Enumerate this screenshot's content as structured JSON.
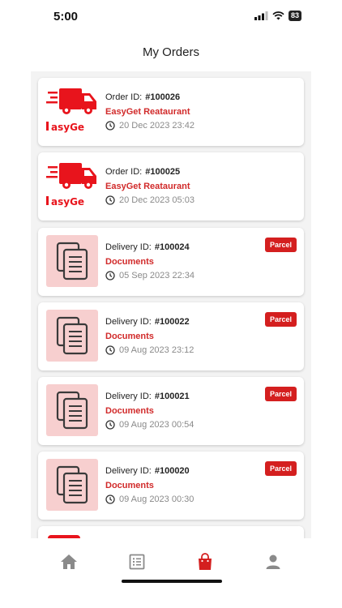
{
  "status_bar": {
    "time": "5:00",
    "battery": "83"
  },
  "header": {
    "title": "My Orders"
  },
  "colors": {
    "accent": "#d12a2a",
    "badge": "#d41f1f",
    "doc_thumb_bg": "#f7cfcf",
    "tab_inactive": "#8a8a8a"
  },
  "orders": [
    {
      "id_label": "Order ID:",
      "id_value": "#100026",
      "subtitle": "EasyGet Reataurant",
      "datetime": "20 Dec 2023  23:42",
      "thumb": "easyget-logo",
      "brand_text": "asyGe"
    },
    {
      "id_label": "Order ID:",
      "id_value": "#100025",
      "subtitle": "EasyGet Reataurant",
      "datetime": "20 Dec 2023  05:03",
      "thumb": "easyget-logo",
      "brand_text": "asyGe"
    },
    {
      "id_label": "Delivery ID:",
      "id_value": "#100024",
      "subtitle": "Documents",
      "datetime": "05 Sep 2023  22:34",
      "thumb": "documents-icon",
      "badge": "Parcel"
    },
    {
      "id_label": "Delivery ID:",
      "id_value": "#100022",
      "subtitle": "Documents",
      "datetime": "09 Aug 2023  23:12",
      "thumb": "documents-icon",
      "badge": "Parcel"
    },
    {
      "id_label": "Delivery ID:",
      "id_value": "#100021",
      "subtitle": "Documents",
      "datetime": "09 Aug 2023  00:54",
      "thumb": "documents-icon",
      "badge": "Parcel"
    },
    {
      "id_label": "Delivery ID:",
      "id_value": "#100020",
      "subtitle": "Documents",
      "datetime": "09 Aug 2023  00:30",
      "thumb": "documents-icon",
      "badge": "Parcel"
    }
  ],
  "tab_bar": {
    "tabs": [
      {
        "icon": "home-icon",
        "active": false
      },
      {
        "icon": "list-icon",
        "active": false
      },
      {
        "icon": "shopping-bag-icon",
        "active": true
      },
      {
        "icon": "profile-icon",
        "active": false
      }
    ]
  }
}
